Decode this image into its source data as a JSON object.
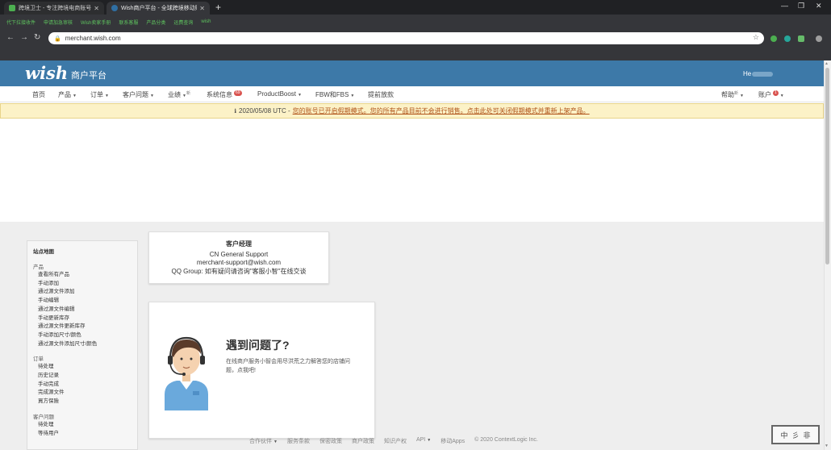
{
  "browser": {
    "tabs": [
      {
        "title": "跨境卫士 - 专注跨境电商账号安全",
        "active": false
      },
      {
        "title": "Wish商户平台 - 全球跨境移动购物",
        "active": true
      }
    ],
    "address": "merchant.wish.com",
    "bookmarks": [
      "代下拉接收件",
      "申请加急审核",
      "Wish卖家手册",
      "联系客服",
      "产品分类",
      "运费查询",
      "wish"
    ]
  },
  "header": {
    "logo": "wish",
    "portal_name": "商户平台",
    "user_name": "He"
  },
  "nav": {
    "home": "首页",
    "products": "产品",
    "orders": "订单",
    "customer_issues": "客户问题",
    "performance": "业绩",
    "new_sup": "新",
    "system_info": "系统信息",
    "system_info_badge": "69",
    "productboost": "ProductBoost",
    "fbw": "FBW和FBS",
    "payment": "提前放款",
    "help": "帮助",
    "account": "账户",
    "account_badge": "1"
  },
  "alert": {
    "date": "2020/05/08 UTC -",
    "message": "您的账号已开启假期模式。您的所有产品目前不会进行销售。点击此处可关闭假期模式并重新上架产品。"
  },
  "sidebar": {
    "title": "站点地图",
    "sections": [
      {
        "heading": "产品",
        "links": [
          "查看所有产品",
          "手动添加",
          "通过源文件添加",
          "手动编辑",
          "通过源文件编辑",
          "手动更新库存",
          "通过源文件更新库存",
          "手动添加尺寸/颜色",
          "通过源文件添加尺寸/颜色"
        ]
      },
      {
        "heading": "订单",
        "links": [
          "待处理",
          "历史记录",
          "手动完成",
          "完成源文件",
          "買方保險"
        ]
      },
      {
        "heading": "客户问题",
        "links": [
          "待处理",
          "等待用户"
        ]
      }
    ]
  },
  "account_manager": {
    "title": "客户经理",
    "name": "CN General Support",
    "email": "merchant-support@wish.com",
    "qq": "QQ Group: 如有疑问请咨询\"客服小智\"在线交谈"
  },
  "help_card": {
    "question": "遇到问题了?",
    "description": "在线商户服务小智会用尽洪荒之力解答您的店铺问题，点我吧!"
  },
  "footer": {
    "links": [
      "合作伙伴",
      "服务条款",
      "保密政策",
      "商户政策",
      "知识产权",
      "API",
      "移动Apps",
      "© 2020 ContextLogic Inc."
    ]
  },
  "watermark": [
    "中",
    "彡",
    "非"
  ],
  "colors": {
    "wish_blue": "#3d79a8",
    "alert_bg": "#fcf2c7",
    "badge_red": "#d9534f"
  }
}
